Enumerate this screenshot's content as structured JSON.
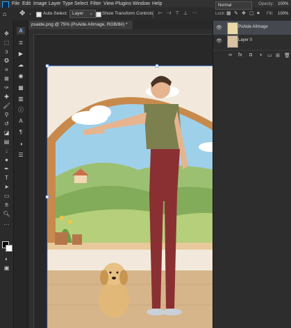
{
  "menu": [
    "File",
    "Edit",
    "Image",
    "Layer",
    "Type",
    "Select",
    "Filter",
    "View",
    "Plugins",
    "Window",
    "Help"
  ],
  "options": {
    "auto_select_label": "Auto-Select:",
    "auto_select_value": "Layer",
    "show_transform_label": "Show Transform Controls"
  },
  "right_controls": {
    "blend_mode": "Normal",
    "opacity_label": "Opacity:",
    "opacity_value": "100%",
    "lock_label": "Lock:",
    "fill_label": "Fill:",
    "fill_value": "100%"
  },
  "document": {
    "tab_title": "psaide.png @ 75% (PsAide AIImage, RGB/8#) *",
    "close_glyph": "×"
  },
  "layers": [
    {
      "name": "PsAide AIImage",
      "selected": true
    },
    {
      "name": "Layer 0",
      "selected": false
    }
  ],
  "colors": {
    "accent": "#3d5a80",
    "canvas_bg": "#f2e9dc"
  }
}
